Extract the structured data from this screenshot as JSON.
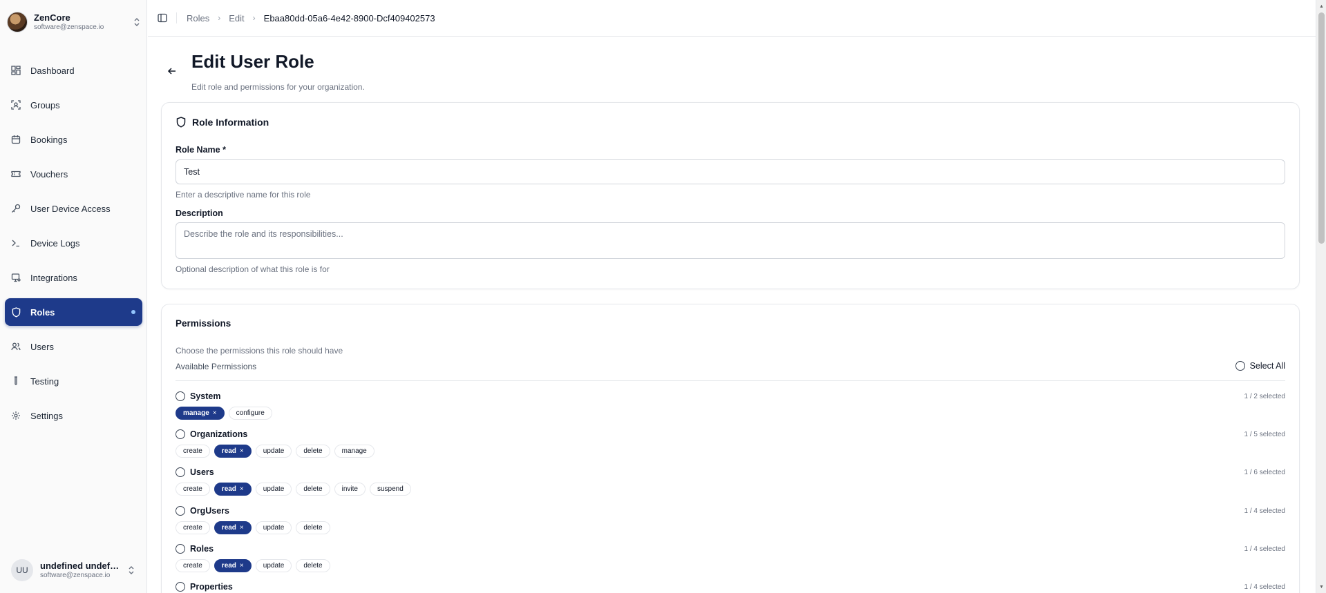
{
  "org": {
    "name": "ZenCore",
    "email": "software@zenspace.io"
  },
  "nav": [
    {
      "id": "dashboard",
      "label": "Dashboard",
      "icon": "dashboard-icon",
      "active": false
    },
    {
      "id": "groups",
      "label": "Groups",
      "icon": "groups-icon",
      "active": false
    },
    {
      "id": "bookings",
      "label": "Bookings",
      "icon": "calendar-icon",
      "active": false
    },
    {
      "id": "vouchers",
      "label": "Vouchers",
      "icon": "ticket-icon",
      "active": false
    },
    {
      "id": "user-device-access",
      "label": "User Device Access",
      "icon": "key-icon",
      "active": false
    },
    {
      "id": "device-logs",
      "label": "Device Logs",
      "icon": "terminal-icon",
      "active": false
    },
    {
      "id": "integrations",
      "label": "Integrations",
      "icon": "plug-icon",
      "active": false
    },
    {
      "id": "roles",
      "label": "Roles",
      "icon": "shield-icon",
      "active": true
    },
    {
      "id": "users",
      "label": "Users",
      "icon": "users-icon",
      "active": false
    },
    {
      "id": "testing",
      "label": "Testing",
      "icon": "test-tube-icon",
      "active": false
    },
    {
      "id": "settings",
      "label": "Settings",
      "icon": "gear-icon",
      "active": false
    }
  ],
  "user": {
    "initials": "UU",
    "name": "undefined undefin...",
    "email": "software@zenspace.io"
  },
  "breadcrumb": [
    "Roles",
    "Edit",
    "Ebaa80dd-05a6-4e42-8900-Dcf409402573"
  ],
  "page": {
    "title": "Edit User Role",
    "subtitle": "Edit role and permissions for your organization."
  },
  "role_info": {
    "title": "Role Information",
    "name_label": "Role Name *",
    "name_value": "Test",
    "name_help": "Enter a descriptive name for this role",
    "desc_label": "Description",
    "desc_placeholder": "Describe the role and its responsibilities...",
    "desc_help": "Optional description of what this role is for"
  },
  "permissions": {
    "title": "Permissions",
    "subtitle": "Choose the permissions this role should have",
    "available_label": "Available Permissions",
    "select_all_label": "Select All",
    "remove_glyph": "×",
    "groups": [
      {
        "name": "System",
        "count": "1 / 2 selected",
        "items": [
          {
            "label": "manage",
            "selected": true
          },
          {
            "label": "configure",
            "selected": false
          }
        ]
      },
      {
        "name": "Organizations",
        "count": "1 / 5 selected",
        "items": [
          {
            "label": "create",
            "selected": false
          },
          {
            "label": "read",
            "selected": true
          },
          {
            "label": "update",
            "selected": false
          },
          {
            "label": "delete",
            "selected": false
          },
          {
            "label": "manage",
            "selected": false
          }
        ]
      },
      {
        "name": "Users",
        "count": "1 / 6 selected",
        "items": [
          {
            "label": "create",
            "selected": false
          },
          {
            "label": "read",
            "selected": true
          },
          {
            "label": "update",
            "selected": false
          },
          {
            "label": "delete",
            "selected": false
          },
          {
            "label": "invite",
            "selected": false
          },
          {
            "label": "suspend",
            "selected": false
          }
        ]
      },
      {
        "name": "OrgUsers",
        "count": "1 / 4 selected",
        "items": [
          {
            "label": "create",
            "selected": false
          },
          {
            "label": "read",
            "selected": true
          },
          {
            "label": "update",
            "selected": false
          },
          {
            "label": "delete",
            "selected": false
          }
        ]
      },
      {
        "name": "Roles",
        "count": "1 / 4 selected",
        "items": [
          {
            "label": "create",
            "selected": false
          },
          {
            "label": "read",
            "selected": true
          },
          {
            "label": "update",
            "selected": false
          },
          {
            "label": "delete",
            "selected": false
          }
        ]
      },
      {
        "name": "Properties",
        "count": "1 / 4 selected",
        "items": []
      }
    ]
  },
  "colors": {
    "accent": "#1e3a8a",
    "muted_text": "#6b7280",
    "border": "#e5e7eb"
  }
}
